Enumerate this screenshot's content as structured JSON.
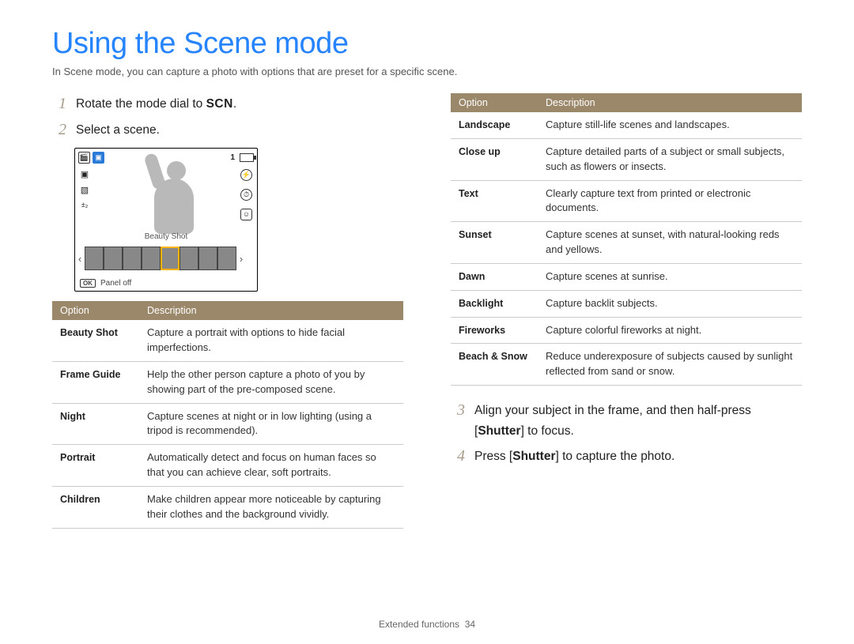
{
  "title": "Using the Scene mode",
  "intro": "In Scene mode, you can capture a photo with options that are preset for a specific scene.",
  "steps": {
    "s1_pre": "Rotate the mode dial to ",
    "s1_scn": "SCN",
    "s1_post": ".",
    "s2": "Select a scene.",
    "s3_pre": "Align your subject in the frame, and then half-press [",
    "s3_bold": "Shutter",
    "s3_post": "] to focus.",
    "s4_pre": "Press [",
    "s4_bold": "Shutter",
    "s4_post": "] to capture the photo."
  },
  "screen": {
    "center_label": "Beauty Shot",
    "ok_label": "OK",
    "panel_label": "Panel off",
    "count": "1"
  },
  "table_header": {
    "opt": "Option",
    "desc": "Description"
  },
  "table_left": [
    {
      "name": "Beauty Shot",
      "desc": "Capture a portrait with options to hide facial imperfections."
    },
    {
      "name": "Frame Guide",
      "desc": "Help the other person capture a photo of you by showing part of the pre-composed scene."
    },
    {
      "name": "Night",
      "desc": "Capture scenes at night or in low lighting (using a tripod is recommended)."
    },
    {
      "name": "Portrait",
      "desc": "Automatically detect and focus on human faces so that you can achieve clear, soft portraits."
    },
    {
      "name": "Children",
      "desc": "Make children appear more noticeable by capturing their clothes and the background vividly."
    }
  ],
  "table_right": [
    {
      "name": "Landscape",
      "desc": "Capture still-life scenes and landscapes."
    },
    {
      "name": "Close up",
      "desc": "Capture detailed parts of a subject or small subjects, such as flowers or insects."
    },
    {
      "name": "Text",
      "desc": "Clearly capture text from printed or electronic documents."
    },
    {
      "name": "Sunset",
      "desc": "Capture scenes at sunset, with natural-looking reds and yellows."
    },
    {
      "name": "Dawn",
      "desc": "Capture scenes at sunrise."
    },
    {
      "name": "Backlight",
      "desc": "Capture backlit subjects."
    },
    {
      "name": "Fireworks",
      "desc": "Capture colorful fireworks at night."
    },
    {
      "name": "Beach & Snow",
      "desc": "Reduce underexposure of subjects caused by sunlight reflected from sand or snow."
    }
  ],
  "footer": {
    "section": "Extended functions",
    "page": "34"
  }
}
